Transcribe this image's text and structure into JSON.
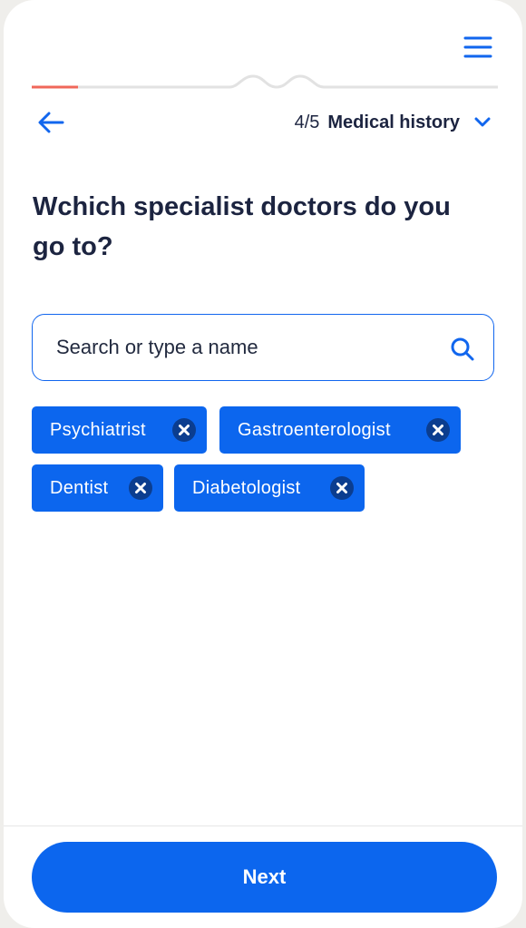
{
  "header": {
    "step_count": "4/5",
    "step_title": "Medical history"
  },
  "progress": {
    "fraction_completed": 0.1
  },
  "question": {
    "text": "Wchich specialist doctors do you go to?"
  },
  "search": {
    "placeholder": "Search or type a name",
    "value": ""
  },
  "selected_specialists": [
    {
      "label": "Psychiatrist"
    },
    {
      "label": "Gastroenterologist"
    },
    {
      "label": "Dentist"
    },
    {
      "label": "Diabetologist"
    }
  ],
  "footer": {
    "next_label": "Next"
  },
  "icons": {
    "menu": "hamburger-menu-icon",
    "back": "arrow-left-icon",
    "expand": "chevron-down-icon",
    "search": "search-icon",
    "remove": "close-icon"
  },
  "colors": {
    "accent": "#0c66ee",
    "progress_done": "#f0675a",
    "text_primary": "#1c2440",
    "chip_remove_bg": "#0b3d8f"
  }
}
